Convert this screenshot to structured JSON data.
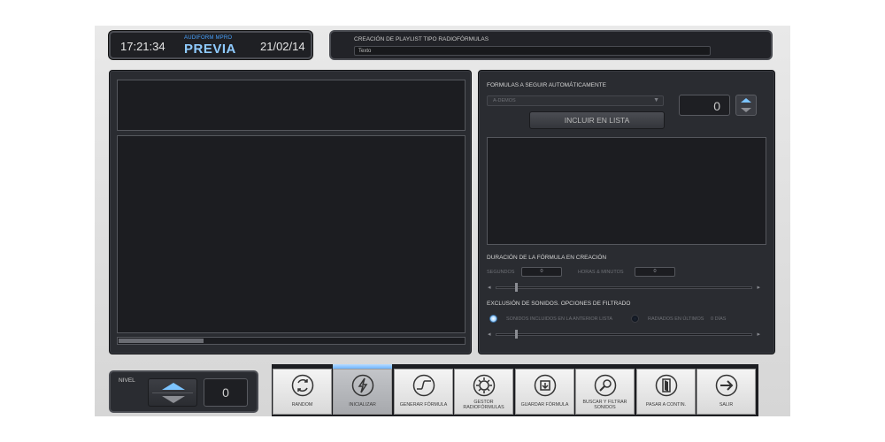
{
  "header": {
    "time": "17:21:34",
    "brand": "AUDIFORM MPRO",
    "mode": "PREVIA",
    "date": "21/02/14",
    "playlist_label": "CREACIÓN DE PLAYLIST TIPO RADIOFÓRMULAS",
    "playlist_value": "Texto"
  },
  "right": {
    "formulas_label": "FORMULAS A SEGUIR AUTOMÁTICAMENTE",
    "formula_selected": "A-DEMOS",
    "formula_count": "0",
    "incluir_label": "INCLUIR EN LISTA",
    "duracion_label": "DURACIÓN DE LA FÓRMULA EN CREACIÓN",
    "segundos_label": "SEGUNDOS",
    "segundos_value": "0",
    "horas_label": "HORAS & MINUTOS",
    "horas_value": "0",
    "exclusion_label": "EXCLUSIÓN DE SONIDOS. OPCIONES DE FILTRADO",
    "radio1_label": "SONIDOS INCLUIDOS EN LA ANTERIOR LISTA",
    "radio2_label": "RADIADOS EN ÚLTIMOS",
    "radio2_value": "0 DÍAS",
    "radio1_selected": true,
    "radio2_selected": false
  },
  "nivel": {
    "label": "NIVEL",
    "value": "0"
  },
  "toolbar": {
    "buttons": [
      {
        "label": "RANDOM",
        "icon": "random-icon"
      },
      {
        "label": "INICIALIZAR",
        "icon": "lightning-icon",
        "active": true
      },
      {
        "label": "GENERAR FÓRMULA",
        "icon": "waveform-icon"
      },
      {
        "label": "GESTOR RADIOFÓRMULAS",
        "icon": "gear-icon"
      },
      {
        "label": "GUARDAR FÓRMULA",
        "icon": "save-icon"
      },
      {
        "label": "BUSCAR Y FILTRAR SONIDOS",
        "icon": "search-icon"
      },
      {
        "label": "PASAR A CONTIN.",
        "icon": "door-icon"
      },
      {
        "label": "SALIR",
        "icon": "exit-arrow-icon"
      }
    ]
  },
  "colors": {
    "accent": "#7cc4ff",
    "panel": "#2a2c31",
    "field": "#1c1d21"
  }
}
